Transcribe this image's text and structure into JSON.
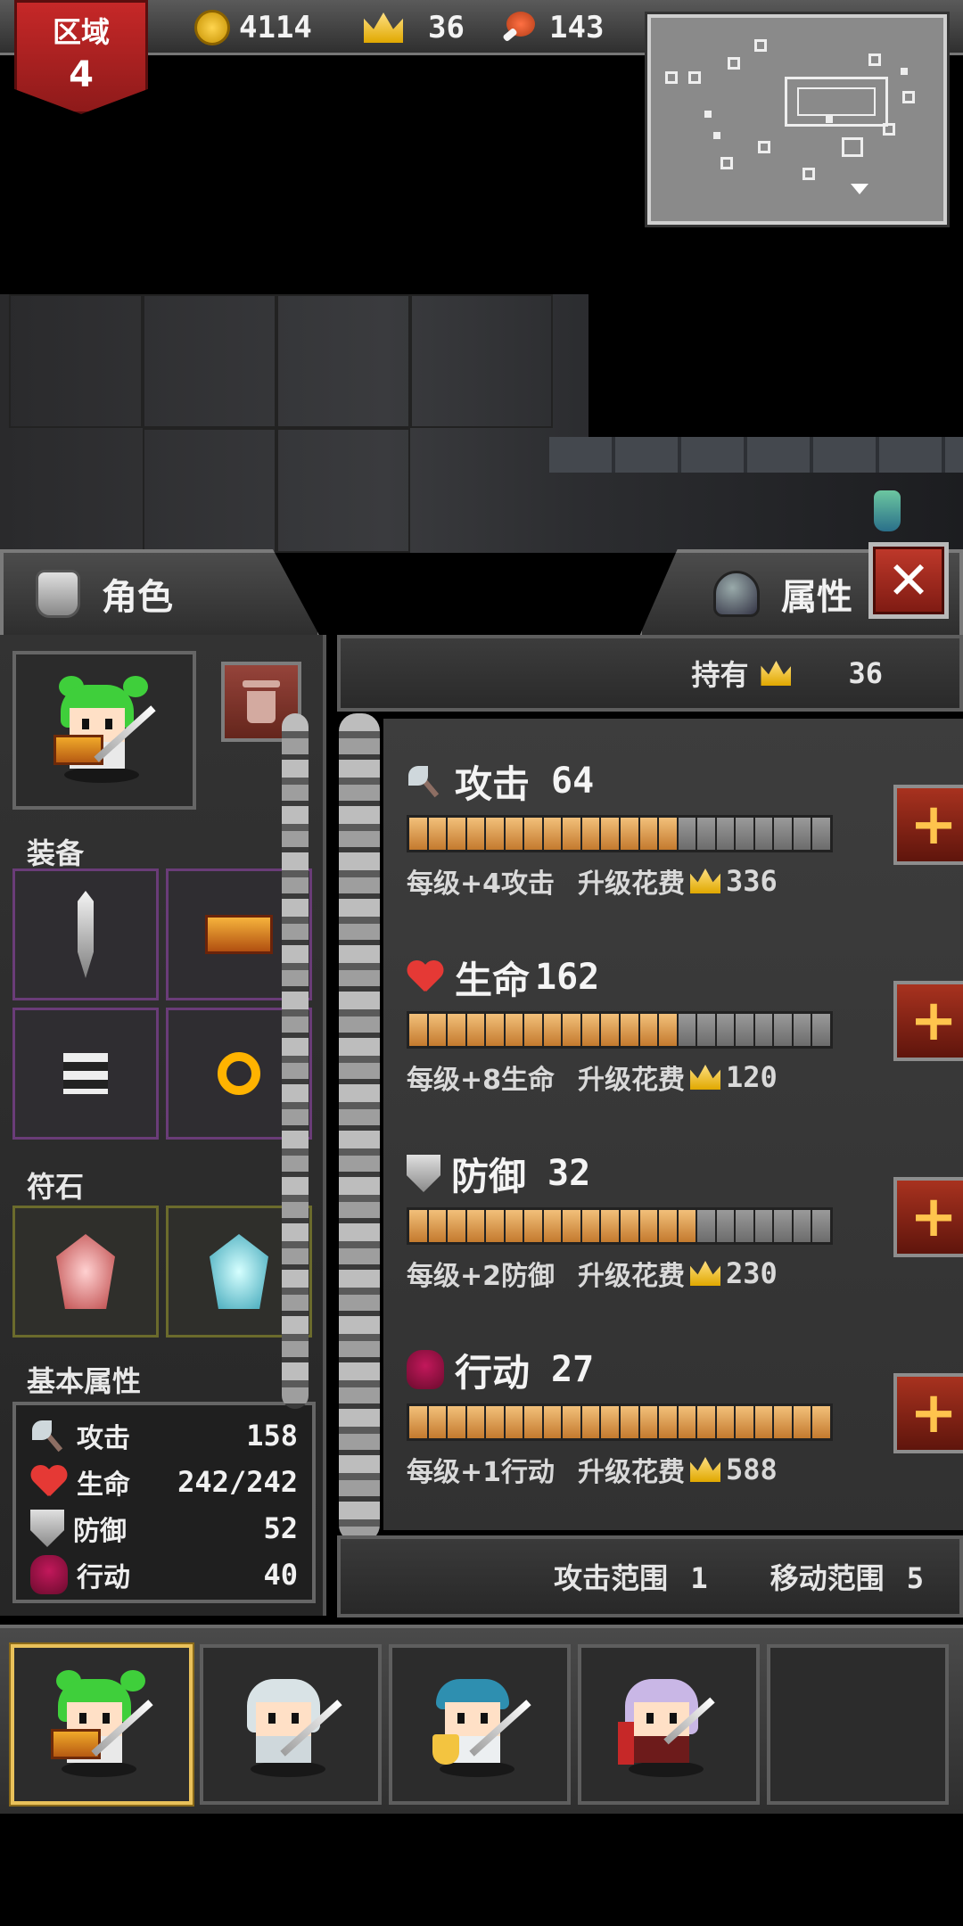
{
  "hud": {
    "region_label": "区域",
    "region_number": "4",
    "coins": "4114",
    "crowns": "36",
    "food": "143",
    "icons": [
      "coin-icon",
      "crown-icon",
      "meat-icon"
    ]
  },
  "tabs": {
    "character": "角色",
    "attributes": "属性"
  },
  "owned": {
    "label": "持有",
    "value": "36"
  },
  "left": {
    "equipment_title": "装备",
    "runes_title": "符石",
    "basic_title": "基本属性",
    "basic": [
      {
        "label": "攻击",
        "value": "158"
      },
      {
        "label": "生命",
        "value": "242/242"
      },
      {
        "label": "防御",
        "value": "52"
      },
      {
        "label": "行动",
        "value": "40"
      }
    ]
  },
  "stats": [
    {
      "name": "攻击",
      "value": "64",
      "per_level": "每级+4攻击",
      "cost_label": "升级花费",
      "cost": "336",
      "filled": 14,
      "total": 22
    },
    {
      "name": "生命",
      "value": "162",
      "per_level": "每级+8生命",
      "cost_label": "升级花费",
      "cost": "120",
      "filled": 14,
      "total": 22
    },
    {
      "name": "防御",
      "value": "32",
      "per_level": "每级+2防御",
      "cost_label": "升级花费",
      "cost": "230",
      "filled": 15,
      "total": 22
    },
    {
      "name": "行动",
      "value": "27",
      "per_level": "每级+1行动",
      "cost_label": "升级花费",
      "cost": "588",
      "filled": 22,
      "total": 22
    }
  ],
  "ranges": {
    "attack_range_label": "攻击范围",
    "attack_range": "1",
    "move_range_label": "移动范围",
    "move_range": "5"
  },
  "colors": {
    "accent_red": "#c0392b",
    "gold": "#ffc44d",
    "bar_fill": "#e2a35a",
    "bar_empty": "#8a8a8a"
  }
}
